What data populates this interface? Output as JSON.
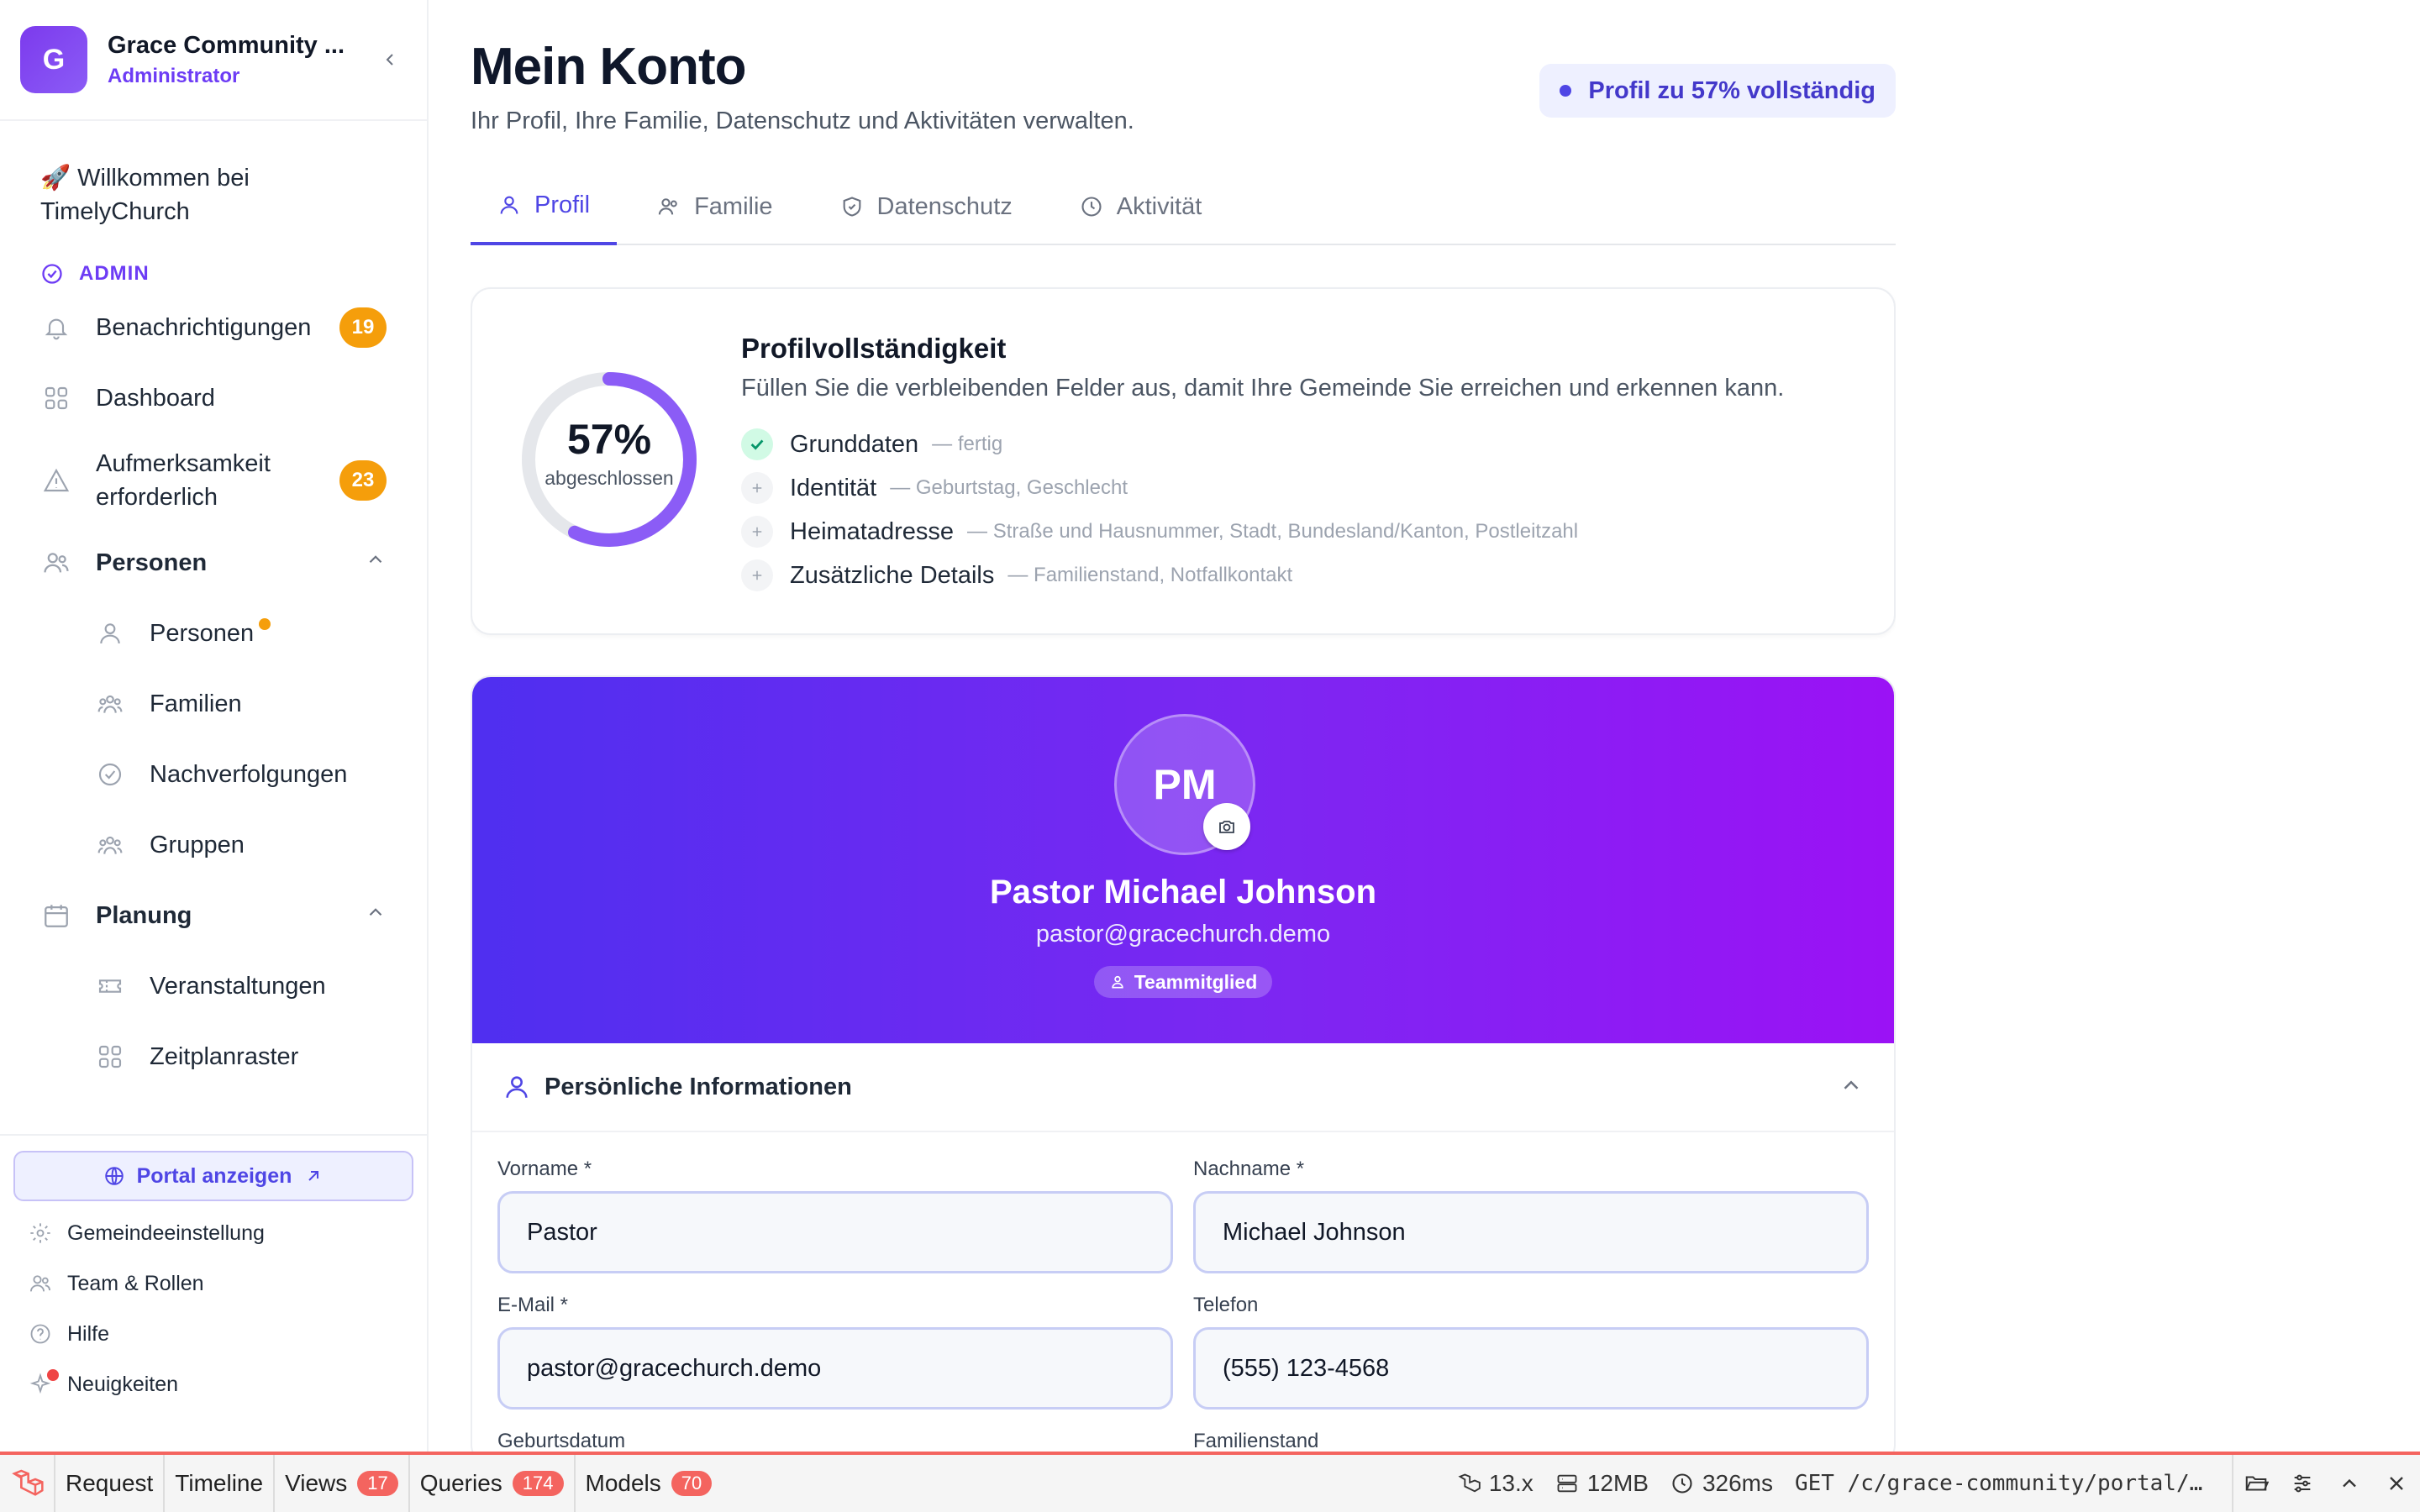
{
  "sidebar": {
    "org_initial": "G",
    "org_name": "Grace Community ...",
    "org_role": "Administrator",
    "welcome": "🚀 Willkommen bei TimelyChurch",
    "section_label": "ADMIN",
    "items": [
      {
        "label": "Benachrichtigungen",
        "badge": "19",
        "icon": "bell-icon"
      },
      {
        "label": "Dashboard",
        "icon": "grid-icon"
      },
      {
        "label": "Aufmerksamkeit erforderlich",
        "badge": "23",
        "icon": "warning-icon"
      }
    ],
    "group_people": {
      "label": "Personen",
      "items": [
        "Personen",
        "Familien",
        "Nachverfolgungen",
        "Gruppen"
      ]
    },
    "group_planning": {
      "label": "Planung",
      "items": [
        "Veranstaltungen",
        "Zeitplanraster"
      ]
    },
    "portal_button": "Portal anzeigen",
    "utility": [
      "Gemeindeeinstellung",
      "Team & Rollen",
      "Hilfe",
      "Neuigkeiten"
    ]
  },
  "header": {
    "title": "Mein Konto",
    "subtitle": "Ihr Profil, Ihre Familie, Datenschutz und Aktivitäten verwalten.",
    "completion_pill": "Profil zu 57% vollständig"
  },
  "tabs": [
    {
      "label": "Profil",
      "active": true
    },
    {
      "label": "Familie",
      "active": false
    },
    {
      "label": "Datenschutz",
      "active": false
    },
    {
      "label": "Aktivität",
      "active": false
    }
  ],
  "completeness": {
    "percent_value": 0.57,
    "percent_text": "57%",
    "ring_label": "abgeschlossen",
    "title": "Profilvollständigkeit",
    "description": "Füllen Sie die verbleibenden Felder aus, damit Ihre Gemeinde Sie erreichen und erkennen kann.",
    "items": [
      {
        "label": "Grunddaten",
        "hint": "— fertig",
        "done": true
      },
      {
        "label": "Identität",
        "hint": "— Geburtstag, Geschlecht",
        "done": false
      },
      {
        "label": "Heimatadresse",
        "hint": "— Straße und Hausnummer, Stadt, Bundesland/Kanton, Postleitzahl",
        "done": false
      },
      {
        "label": "Zusätzliche Details",
        "hint": "— Familienstand, Notfallkontakt",
        "done": false
      }
    ]
  },
  "profile": {
    "initials": "PM",
    "name": "Pastor Michael Johnson",
    "email": "pastor@gracechurch.demo",
    "role_badge": "Teammitglied"
  },
  "personal_info": {
    "title": "Persönliche Informationen",
    "fields": {
      "first_name": {
        "label": "Vorname *",
        "value": "Pastor"
      },
      "last_name": {
        "label": "Nachname *",
        "value": "Michael Johnson"
      },
      "email": {
        "label": "E-Mail *",
        "value": "pastor@gracechurch.demo"
      },
      "phone": {
        "label": "Telefon",
        "value": "(555) 123-4568"
      },
      "birthday": {
        "label": "Geburtsdatum"
      },
      "marital": {
        "label": "Familienstand"
      }
    }
  },
  "debugbar": {
    "tabs": [
      {
        "label": "Request"
      },
      {
        "label": "Timeline"
      },
      {
        "label": "Views",
        "badge": "17"
      },
      {
        "label": "Queries",
        "badge": "174"
      },
      {
        "label": "Models",
        "badge": "70"
      }
    ],
    "version": "13.x",
    "memory": "12MB",
    "time": "326ms",
    "url": "GET /c/grace-community/portal/pro..."
  },
  "colors": {
    "accent": "#4f46e5",
    "brand_purple": "#7c3aed",
    "badge_orange": "#f59e0b",
    "debug_red": "#f4645f"
  }
}
